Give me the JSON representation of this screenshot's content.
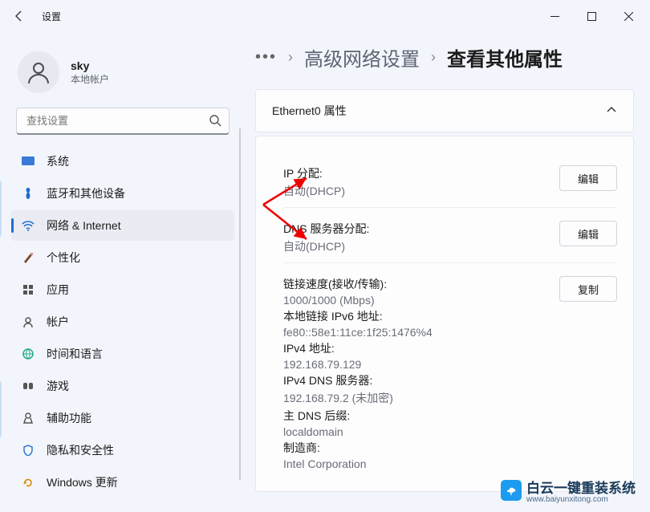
{
  "title": "设置",
  "user": {
    "name": "sky",
    "sub": "本地帐户"
  },
  "search": {
    "placeholder": "查找设置"
  },
  "nav": {
    "items": [
      {
        "label": "系统"
      },
      {
        "label": "蓝牙和其他设备"
      },
      {
        "label": "网络 & Internet"
      },
      {
        "label": "个性化"
      },
      {
        "label": "应用"
      },
      {
        "label": "帐户"
      },
      {
        "label": "时间和语言"
      },
      {
        "label": "游戏"
      },
      {
        "label": "辅助功能"
      },
      {
        "label": "隐私和安全性"
      },
      {
        "label": "Windows 更新"
      }
    ],
    "activeIndex": 2
  },
  "breadcrumb": {
    "link": "高级网络设置",
    "current": "查看其他属性"
  },
  "card": {
    "title": "Ethernet0 属性",
    "buttons": {
      "edit": "编辑",
      "copy": "复制"
    },
    "ip": {
      "label": "IP 分配:",
      "value": "自动(DHCP)"
    },
    "dns": {
      "label": "DNS 服务器分配:",
      "value": "自动(DHCP)"
    },
    "details": {
      "speedLabel": "链接速度(接收/传输):",
      "speedValue": "1000/1000 (Mbps)",
      "ipv6Label": "本地链接 IPv6 地址:",
      "ipv6Value": "fe80::58e1:11ce:1f25:1476%4",
      "ipv4Label": "IPv4 地址:",
      "ipv4Value": "192.168.79.129",
      "ipv4DnsLabel": "IPv4 DNS 服务器:",
      "ipv4DnsValue": "192.168.79.2 (未加密)",
      "dnsSuffixLabel": "主 DNS 后缀:",
      "dnsSuffixValue": "localdomain",
      "mfrLabel": "制造商:",
      "mfrValue": "Intel Corporation"
    }
  },
  "watermark": {
    "line1": "白云一键重装系统",
    "line2": "www.baiyunxitong.com"
  }
}
